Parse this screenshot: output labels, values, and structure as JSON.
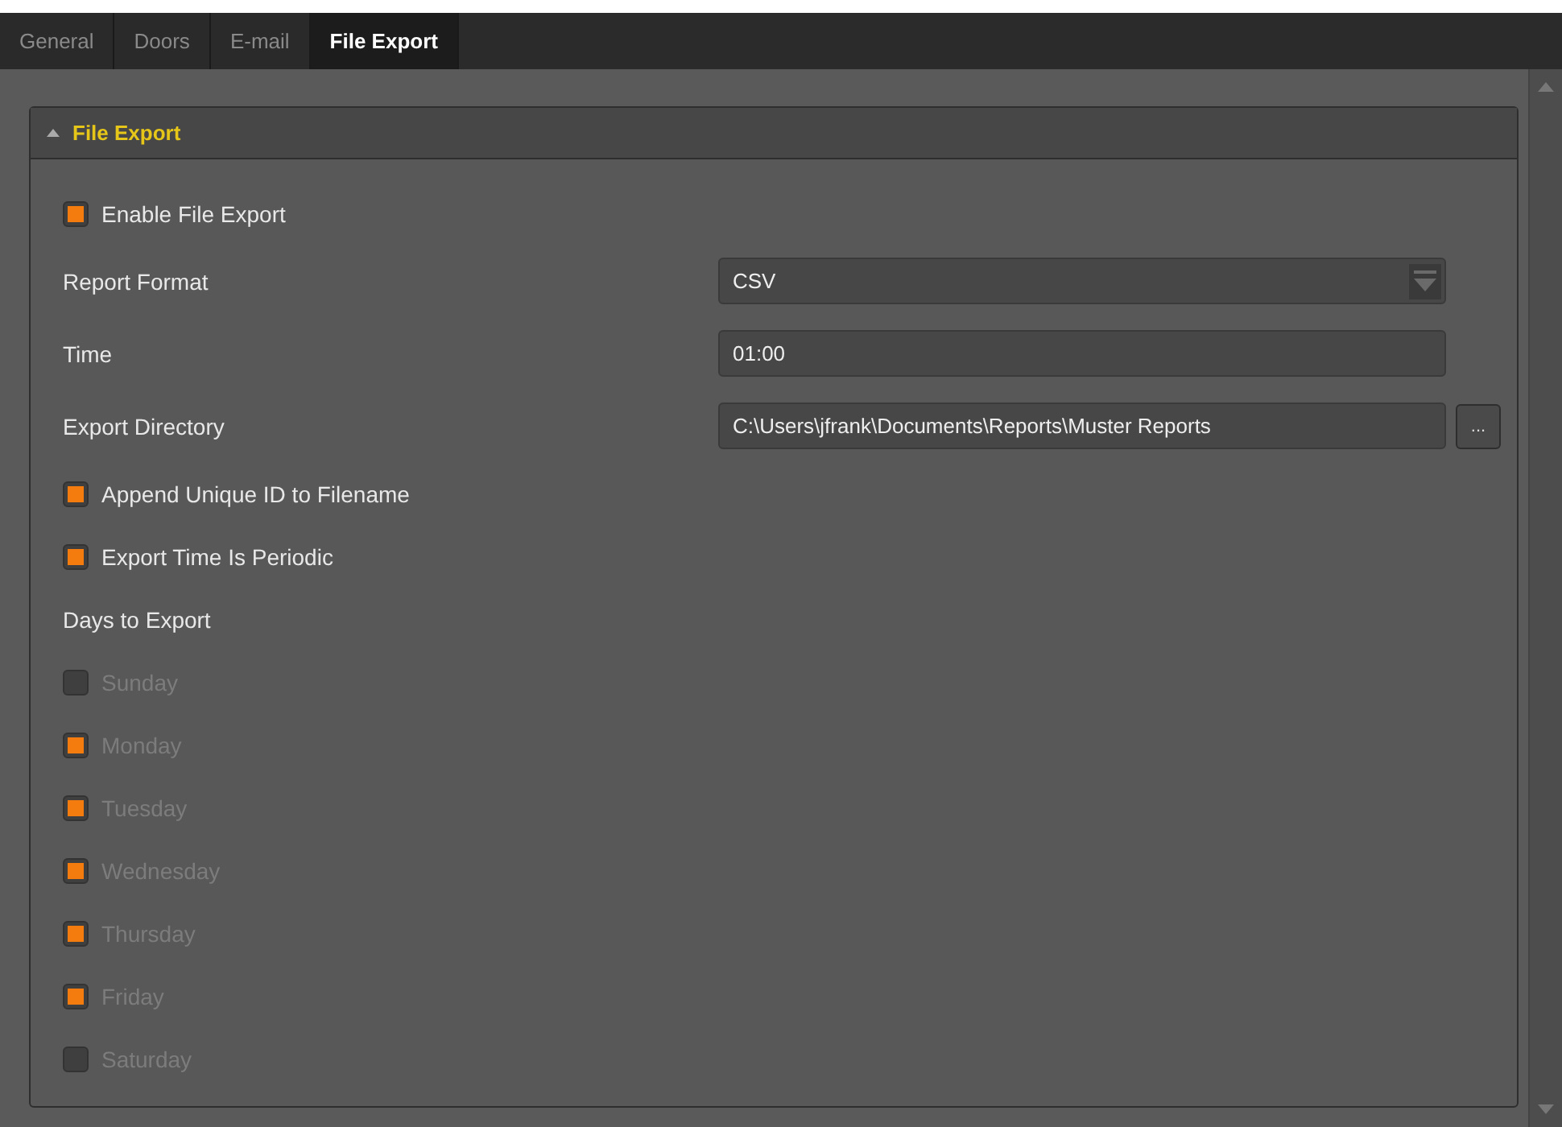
{
  "tabs": [
    {
      "label": "General",
      "selected": false
    },
    {
      "label": "Doors",
      "selected": false
    },
    {
      "label": "E-mail",
      "selected": false
    },
    {
      "label": "File Export",
      "selected": true
    }
  ],
  "section": {
    "title": "File Export",
    "expanded": true
  },
  "rows": [
    {
      "kind": "checkbox",
      "label": "Enable File Export",
      "checked": true,
      "disabled": false
    },
    {
      "kind": "select",
      "label": "Report Format",
      "value": "CSV"
    },
    {
      "kind": "text",
      "label": "Time",
      "value": "01:00"
    },
    {
      "kind": "path",
      "label": "Export Directory",
      "value": "C:\\Users\\jfrank\\Documents\\Reports\\Muster Reports",
      "button": "..."
    },
    {
      "kind": "checkbox",
      "label": "Append Unique ID to Filename",
      "checked": true,
      "disabled": false
    },
    {
      "kind": "checkbox",
      "label": "Export Time Is Periodic",
      "checked": true,
      "disabled": false
    },
    {
      "kind": "heading",
      "label": "Days to Export"
    },
    {
      "kind": "checkbox",
      "label": "Sunday",
      "checked": false,
      "disabled": true
    },
    {
      "kind": "checkbox",
      "label": "Monday",
      "checked": true,
      "disabled": true
    },
    {
      "kind": "checkbox",
      "label": "Tuesday",
      "checked": true,
      "disabled": true
    },
    {
      "kind": "checkbox",
      "label": "Wednesday",
      "checked": true,
      "disabled": true
    },
    {
      "kind": "checkbox",
      "label": "Thursday",
      "checked": true,
      "disabled": true
    },
    {
      "kind": "checkbox",
      "label": "Friday",
      "checked": true,
      "disabled": true
    },
    {
      "kind": "checkbox",
      "label": "Saturday",
      "checked": false,
      "disabled": true
    }
  ]
}
